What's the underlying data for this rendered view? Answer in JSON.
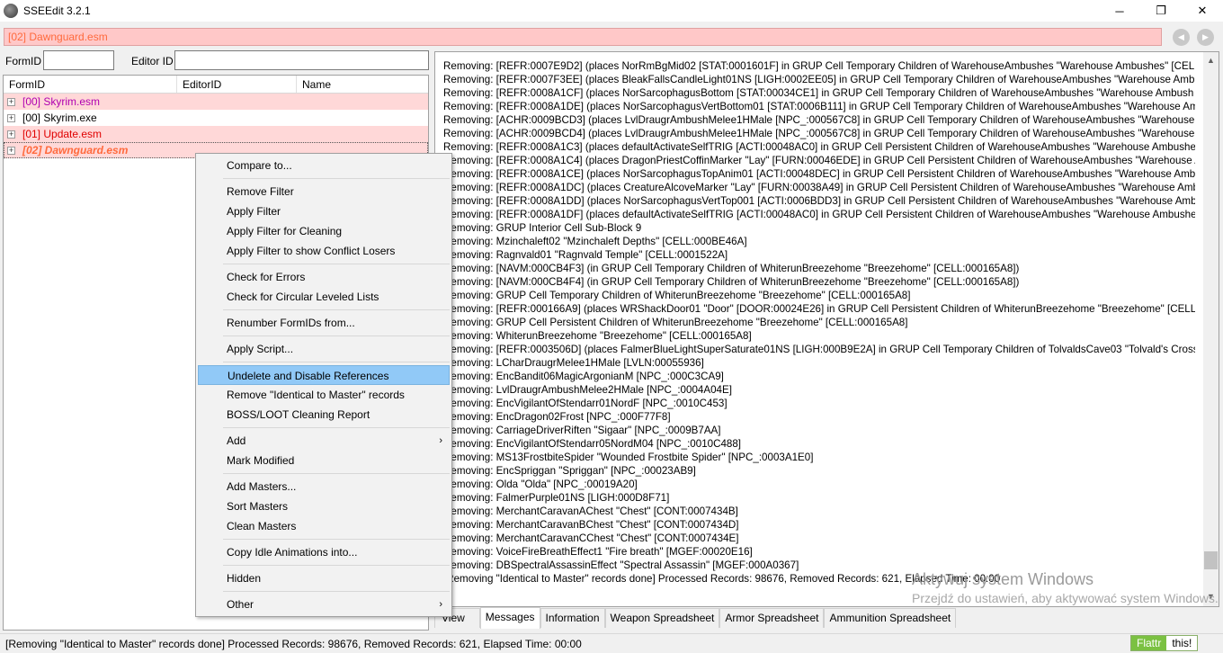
{
  "window": {
    "title": "SSEEdit 3.2.1",
    "minimize": "─",
    "maximize": "❐",
    "close": "✕"
  },
  "path": "[02] Dawnguard.esm",
  "nav": {
    "back": "◀",
    "forward": "▶"
  },
  "filters": {
    "formid_label": "FormID",
    "editorid_label": "Editor ID",
    "formid_value": "",
    "editorid_value": ""
  },
  "tree": {
    "columns": [
      "FormID",
      "EditorID",
      "Name"
    ],
    "rows": [
      {
        "label": "[00] Skyrim.esm",
        "expander": "+"
      },
      {
        "label": "[00] Skyrim.exe",
        "expander": "+"
      },
      {
        "label": "[01] Update.esm",
        "expander": "+"
      },
      {
        "label": "[02] Dawnguard.esm",
        "expander": "+"
      }
    ]
  },
  "menu": {
    "items": [
      "Compare to...",
      "Remove Filter",
      "Apply Filter",
      "Apply Filter for Cleaning",
      "Apply Filter to show Conflict Losers",
      "Check for Errors",
      "Check for Circular Leveled Lists",
      "Renumber FormIDs from...",
      "Apply Script...",
      "Undelete and Disable References",
      "Remove \"Identical to Master\" records",
      "BOSS/LOOT Cleaning Report",
      "Add",
      "Mark Modified",
      "Add Masters...",
      "Sort Masters",
      "Clean Masters",
      "Copy Idle Animations into...",
      "Hidden",
      "Other"
    ],
    "submenu_arrow": "›"
  },
  "log": {
    "lines": [
      "Removing: [REFR:0007E9D2] (places NorRmBgMid02 [STAT:0001601F] in GRUP Cell Temporary Children of WarehouseAmbushes \"Warehouse Ambushes\" [CELL:",
      "Removing: [REFR:0007F3EE] (places BleakFallsCandleLight01NS [LIGH:0002EE05] in GRUP Cell Temporary Children of WarehouseAmbushes \"Warehouse Ambus",
      "Removing: [REFR:0008A1CF] (places NorSarcophagusBottom [STAT:00034CE1] in GRUP Cell Temporary Children of WarehouseAmbushes \"Warehouse Ambush",
      "Removing: [REFR:0008A1DE] (places NorSarcophagusVertBottom01 [STAT:0006B111] in GRUP Cell Temporary Children of WarehouseAmbushes \"Warehouse Am",
      "Removing: [ACHR:0009BCD3] (places LvlDraugrAmbushMelee1HMale [NPC_:000567C8] in GRUP Cell Temporary Children of WarehouseAmbushes \"Warehouse",
      "Removing: [ACHR:0009BCD4] (places LvlDraugrAmbushMelee1HMale [NPC_:000567C8] in GRUP Cell Temporary Children of WarehouseAmbushes \"Warehouse",
      "Removing: [REFR:0008A1C3] (places defaultActivateSelfTRIG [ACTI:00048AC0] in GRUP Cell Persistent Children of WarehouseAmbushes \"Warehouse Ambushes",
      "Removing: [REFR:0008A1C4] (places DragonPriestCoffinMarker \"Lay\" [FURN:00046EDE] in GRUP Cell Persistent Children of WarehouseAmbushes \"Warehouse A",
      "Removing: [REFR:0008A1CE] (places NorSarcophagusTopAnim01 [ACTI:00048DEC] in GRUP Cell Persistent Children of WarehouseAmbushes \"Warehouse Ambus",
      "Removing: [REFR:0008A1DC] (places CreatureAlcoveMarker \"Lay\" [FURN:00038A49] in GRUP Cell Persistent Children of WarehouseAmbushes \"Warehouse Amb",
      "Removing: [REFR:0008A1DD] (places NorSarcophagusVertTop001 [ACTI:0006BDD3] in GRUP Cell Persistent Children of WarehouseAmbushes \"Warehouse Ambu",
      "Removing: [REFR:0008A1DF] (places defaultActivateSelfTRIG [ACTI:00048AC0] in GRUP Cell Persistent Children of WarehouseAmbushes \"Warehouse Ambushes",
      "Removing: GRUP Interior Cell Sub-Block 9",
      "Removing: Mzinchaleft02 \"Mzinchaleft Depths\" [CELL:000BE46A]",
      "Removing: Ragnvald01 \"Ragnvald Temple\" [CELL:0001522A]",
      "Removing: [NAVM:000CB4F3] (in GRUP Cell Temporary Children of WhiterunBreezehome \"Breezehome\" [CELL:000165A8])",
      "Removing: [NAVM:000CB4F4] (in GRUP Cell Temporary Children of WhiterunBreezehome \"Breezehome\" [CELL:000165A8])",
      "Removing: GRUP Cell Temporary Children of WhiterunBreezehome \"Breezehome\" [CELL:000165A8]",
      "Removing: [REFR:000166A9] (places WRShackDoor01 \"Door\" [DOOR:00024E26] in GRUP Cell Persistent Children of WhiterunBreezehome \"Breezehome\" [CELL:0",
      "Removing: GRUP Cell Persistent Children of WhiterunBreezehome \"Breezehome\" [CELL:000165A8]",
      "Removing: WhiterunBreezehome \"Breezehome\" [CELL:000165A8]",
      "Removing: [REFR:0003506D] (places FalmerBlueLightSuperSaturate01NS [LIGH:000B9E2A] in GRUP Cell Temporary Children of TolvaldsCave03 \"Tolvald's Crossin",
      "Removing: LCharDraugrMelee1HMale [LVLN:00055936]",
      "Removing: EncBandit06MagicArgonianM [NPC_:000C3CA9]",
      "Removing: LvlDraugrAmbushMelee2HMale [NPC_:0004A04E]",
      "Removing: EncVigilantOfStendarr01NordF [NPC_:0010C453]",
      "Removing: EncDragon02Frost [NPC_:000F77F8]",
      "Removing: CarriageDriverRiften \"Sigaar\" [NPC_:0009B7AA]",
      "Removing: EncVigilantOfStendarr05NordM04 [NPC_:0010C488]",
      "Removing: MS13FrostbiteSpider \"Wounded Frostbite Spider\" [NPC_:0003A1E0]",
      "Removing: EncSpriggan \"Spriggan\" [NPC_:00023AB9]",
      "Removing: Olda \"Olda\" [NPC_:00019A20]",
      "Removing: FalmerPurple01NS [LIGH:000D8F71]",
      "Removing: MerchantCaravanAChest \"Chest\" [CONT:0007434B]",
      "Removing: MerchantCaravanBChest \"Chest\" [CONT:0007434D]",
      "Removing: MerchantCaravanCChest \"Chest\" [CONT:0007434E]",
      "Removing: VoiceFireBreathEffect1 \"Fire breath\" [MGEF:00020E16]",
      "Removing: DBSpectralAssassinEffect \"Spectral Assassin\" [MGEF:000A0367]",
      "[Removing \"Identical to Master\" records done]  Processed Records: 98676, Removed Records: 621, Elapsed Time: 00:00"
    ],
    "scroll_up": "▲",
    "scroll_down": "▼"
  },
  "watermark": {
    "title": "Aktywuj system Windows",
    "subtitle": "Przejdź do ustawień, aby aktywować system Windows."
  },
  "tabs": [
    "View",
    "Messages",
    "Information",
    "Weapon Spreadsheet",
    "Armor Spreadsheet",
    "Ammunition Spreadsheet"
  ],
  "status": "[Removing \"Identical to Master\" records done]  Processed Records: 98676, Removed Records: 621, Elapsed Time: 00:00",
  "flattr": {
    "left": "Flattr",
    "right": "this!"
  }
}
